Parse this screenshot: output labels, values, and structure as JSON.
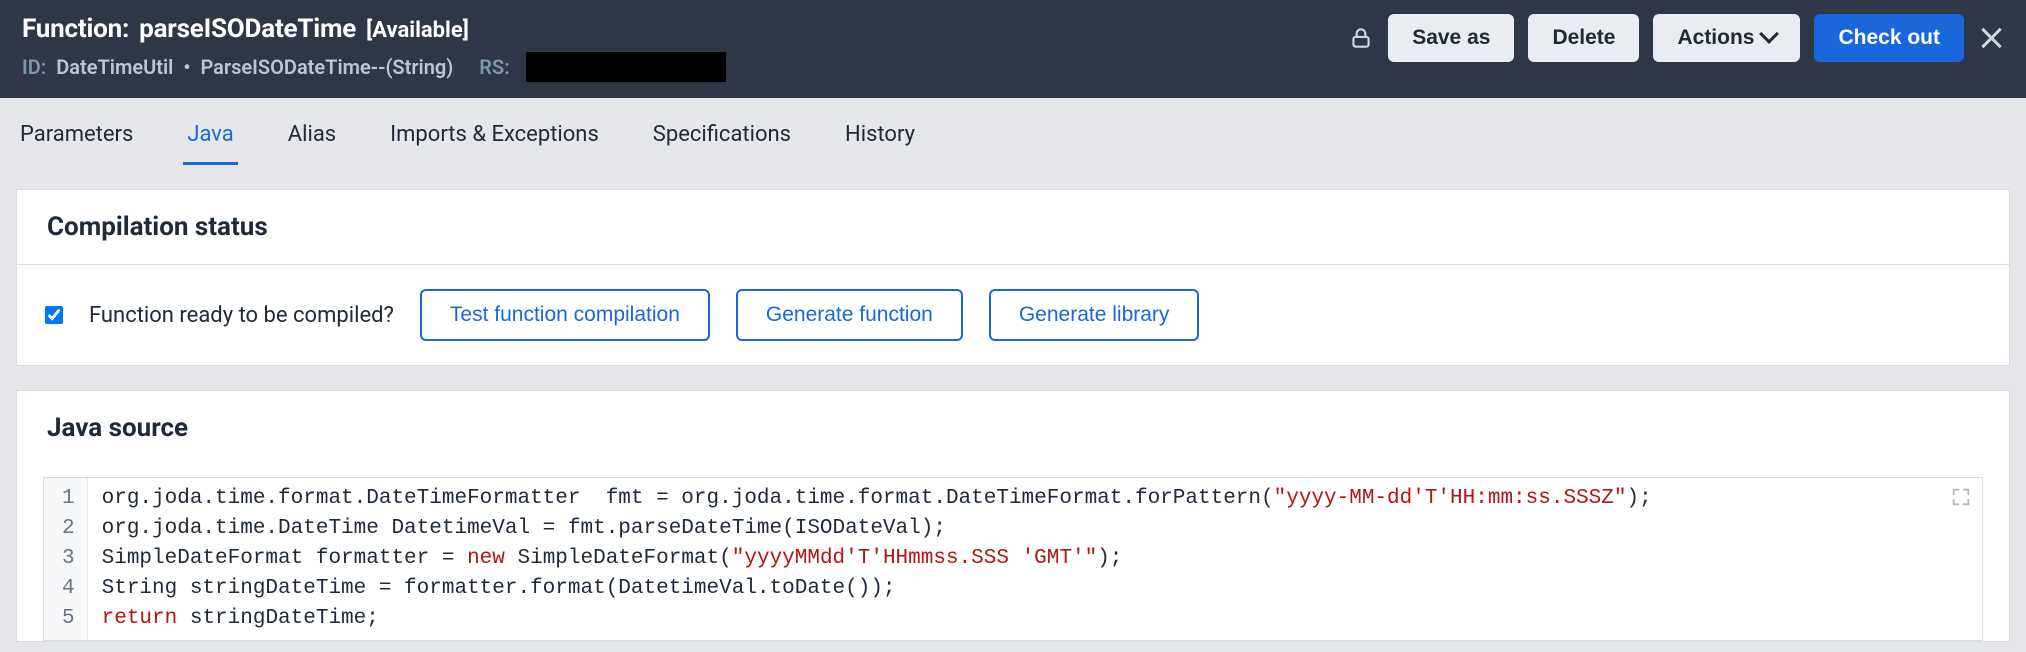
{
  "header": {
    "title_prefix": "Function:",
    "title_name": "parseISODateTime",
    "title_status": "[Available]",
    "id_label": "ID:",
    "id_class": "DateTimeUtil",
    "id_method": "ParseISODateTime--(String)",
    "rs_label": "RS:"
  },
  "actions": {
    "save_as": "Save as",
    "delete": "Delete",
    "actions": "Actions",
    "check_out": "Check out"
  },
  "tabs": {
    "items": [
      "Parameters",
      "Java",
      "Alias",
      "Imports & Exceptions",
      "Specifications",
      "History"
    ],
    "active_index": 1
  },
  "compilation": {
    "heading": "Compilation status",
    "checkbox_label": "Function ready to be compiled?",
    "checkbox_checked": true,
    "test_btn": "Test function compilation",
    "gen_fn_btn": "Generate function",
    "gen_lib_btn": "Generate library"
  },
  "java_source": {
    "heading": "Java source",
    "lines": [
      {
        "n": 1,
        "segments": [
          {
            "t": "org.joda.time.format.DateTimeFormatter  fmt = org.joda.time.format.DateTimeFormat.forPattern(",
            "c": ""
          },
          {
            "t": "\"yyyy-MM-dd'T'HH:mm:ss.SSSZ\"",
            "c": "tok-str"
          },
          {
            "t": ");",
            "c": ""
          }
        ]
      },
      {
        "n": 2,
        "segments": [
          {
            "t": "org.joda.time.DateTime DatetimeVal = fmt.parseDateTime(ISODateVal);",
            "c": ""
          }
        ]
      },
      {
        "n": 3,
        "segments": [
          {
            "t": "SimpleDateFormat formatter = ",
            "c": ""
          },
          {
            "t": "new",
            "c": "tok-kw"
          },
          {
            "t": " SimpleDateFormat(",
            "c": ""
          },
          {
            "t": "\"yyyyMMdd'T'HHmmss.SSS 'GMT'\"",
            "c": "tok-str"
          },
          {
            "t": ");",
            "c": ""
          }
        ]
      },
      {
        "n": 4,
        "segments": [
          {
            "t": "String stringDateTime = formatter.format(DatetimeVal.toDate());",
            "c": ""
          }
        ]
      },
      {
        "n": 5,
        "segments": [
          {
            "t": "return",
            "c": "tok-kw"
          },
          {
            "t": " stringDateTime;",
            "c": ""
          }
        ]
      }
    ]
  }
}
